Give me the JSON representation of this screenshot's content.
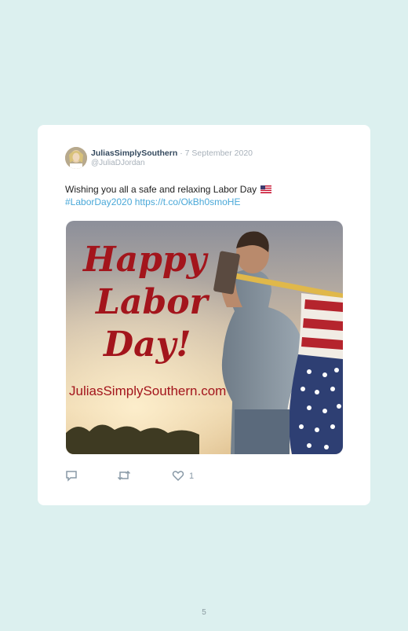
{
  "tweet": {
    "user_name": "JuliasSimplySouthern",
    "separator": "·",
    "date": "7 September 2020",
    "handle": "@JuliaDJordan",
    "text": "Wishing you all a safe and relaxing Labor Day",
    "flag_icon": "us-flag-emoji",
    "hashtag": "#LaborDay2020",
    "link": "https://t.co/OkBh0smoHE",
    "image": {
      "line1": "Happy",
      "line2": "Labor",
      "line3": "Day!",
      "site": "JuliasSimplySouthern.com"
    },
    "like_count": "1",
    "icons": [
      "reply-icon",
      "retweet-icon",
      "heart-icon"
    ]
  },
  "page": {
    "number": "5"
  },
  "colors": {
    "background": "#dcf0ef",
    "card": "#ffffff",
    "link": "#4aa8d8",
    "script_red": "#a3151c"
  }
}
